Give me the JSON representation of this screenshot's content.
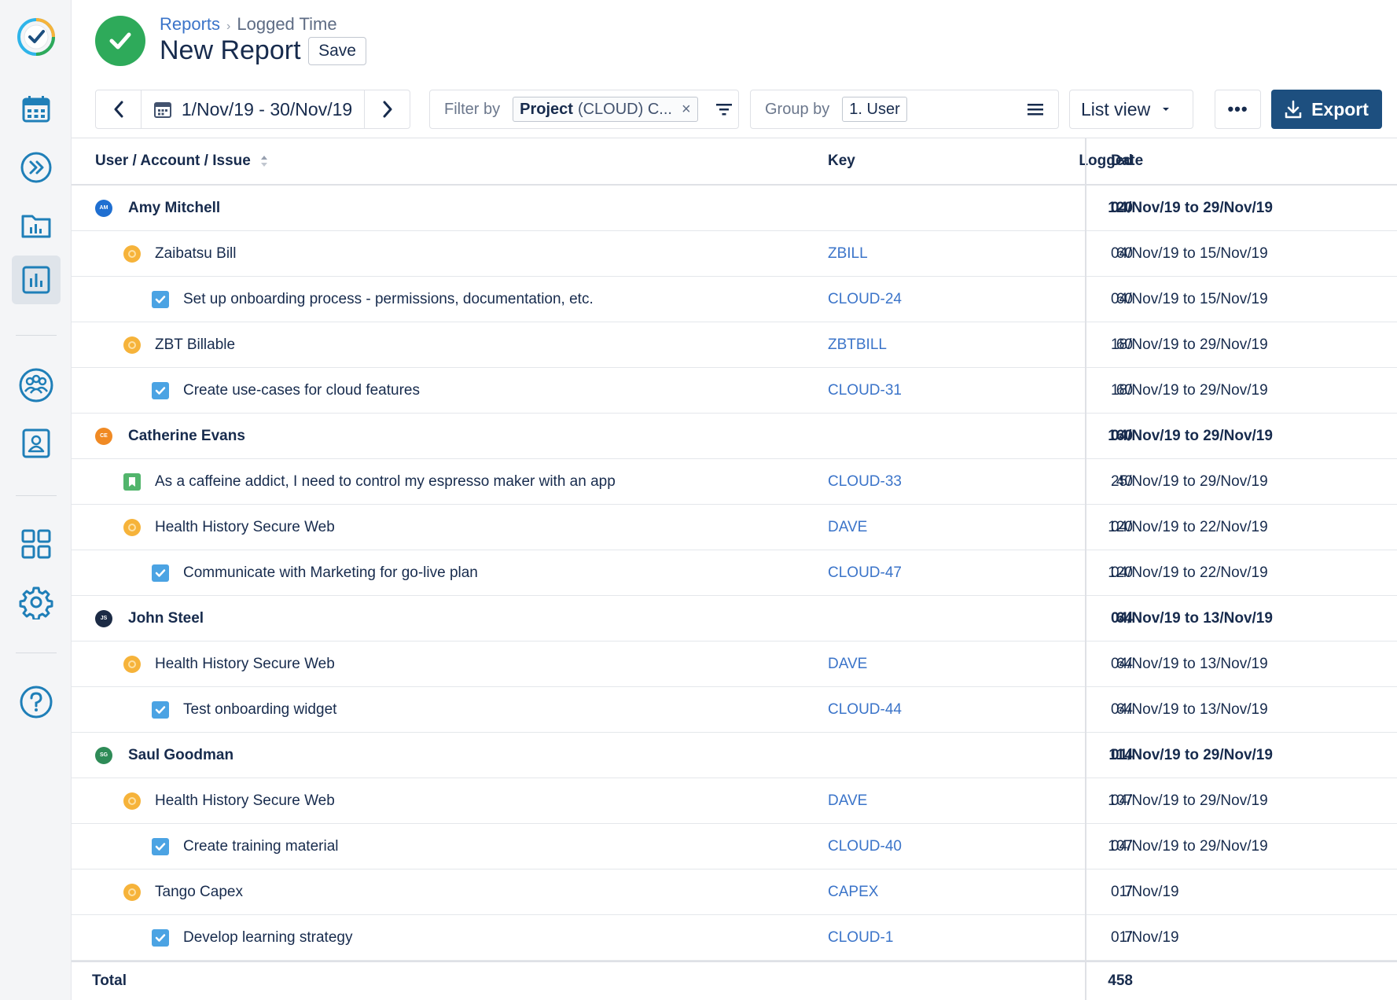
{
  "header": {
    "breadcrumb_root": "Reports",
    "breadcrumb_current": "Logged Time",
    "title": "New Report",
    "save_label": "Save"
  },
  "toolbar": {
    "date_range": "1/Nov/19 - 30/Nov/19",
    "filter_label": "Filter by",
    "filter_chip_key": "Project",
    "filter_chip_value": "(CLOUD) C...",
    "group_label": "Group by",
    "group_value": "1. User",
    "view_label": "List view",
    "more_label": "•••",
    "export_label": "Export"
  },
  "table": {
    "columns": {
      "name": "User / Account / Issue",
      "key": "Key",
      "logged": "Logged",
      "date": "Date"
    },
    "rows": [
      {
        "level": 0,
        "type": "user",
        "initials": "AM",
        "avatar_color": "#1f6fd1",
        "name": "Amy Mitchell",
        "key": "",
        "logged": "120",
        "date": "04/Nov/19 to 29/Nov/19"
      },
      {
        "level": 1,
        "type": "account",
        "name": "Zaibatsu Bill",
        "key": "ZBILL",
        "logged": "60",
        "date": "04/Nov/19 to 15/Nov/19"
      },
      {
        "level": 2,
        "type": "task",
        "name": "Set up onboarding process - permissions, documentation, etc.",
        "key": "CLOUD-24",
        "logged": "60",
        "date": "04/Nov/19 to 15/Nov/19"
      },
      {
        "level": 1,
        "type": "account",
        "name": "ZBT Billable",
        "key": "ZBTBILL",
        "logged": "60",
        "date": "18/Nov/19 to 29/Nov/19"
      },
      {
        "level": 2,
        "type": "task",
        "name": "Create use-cases for cloud features",
        "key": "CLOUD-31",
        "logged": "60",
        "date": "18/Nov/19 to 29/Nov/19"
      },
      {
        "level": 0,
        "type": "user",
        "initials": "CE",
        "avatar_color": "#f08a24",
        "name": "Catherine Evans",
        "key": "",
        "logged": "160",
        "date": "04/Nov/19 to 29/Nov/19"
      },
      {
        "level": 1,
        "type": "story",
        "name": "As a caffeine addict, I need to control my espresso maker with an app",
        "key": "CLOUD-33",
        "logged": "40",
        "date": "25/Nov/19 to 29/Nov/19"
      },
      {
        "level": 1,
        "type": "account",
        "name": "Health History Secure Web",
        "key": "DAVE",
        "logged": "120",
        "date": "04/Nov/19 to 22/Nov/19"
      },
      {
        "level": 2,
        "type": "task",
        "name": "Communicate with Marketing for go-live plan",
        "key": "CLOUD-47",
        "logged": "120",
        "date": "04/Nov/19 to 22/Nov/19"
      },
      {
        "level": 0,
        "type": "user",
        "initials": "JS",
        "avatar_color": "#1c2b45",
        "name": "John Steel",
        "key": "",
        "logged": "64",
        "date": "04/Nov/19 to 13/Nov/19"
      },
      {
        "level": 1,
        "type": "account",
        "name": "Health History Secure Web",
        "key": "DAVE",
        "logged": "64",
        "date": "04/Nov/19 to 13/Nov/19"
      },
      {
        "level": 2,
        "type": "task",
        "name": "Test onboarding widget",
        "key": "CLOUD-44",
        "logged": "64",
        "date": "04/Nov/19 to 13/Nov/19"
      },
      {
        "level": 0,
        "type": "user",
        "initials": "SG",
        "avatar_color": "#2e8b57",
        "name": "Saul Goodman",
        "key": "",
        "logged": "114",
        "date": "01/Nov/19 to 29/Nov/19"
      },
      {
        "level": 1,
        "type": "account",
        "name": "Health History Secure Web",
        "key": "DAVE",
        "logged": "107",
        "date": "04/Nov/19 to 29/Nov/19"
      },
      {
        "level": 2,
        "type": "task",
        "name": "Create training material",
        "key": "CLOUD-40",
        "logged": "107",
        "date": "04/Nov/19 to 29/Nov/19"
      },
      {
        "level": 1,
        "type": "account",
        "name": "Tango Capex",
        "key": "CAPEX",
        "logged": "7",
        "date": "01/Nov/19"
      },
      {
        "level": 2,
        "type": "task",
        "name": "Develop learning strategy",
        "key": "CLOUD-1",
        "logged": "7",
        "date": "01/Nov/19"
      }
    ],
    "total_label": "Total",
    "total_value": "458"
  },
  "sidebar": {
    "items": [
      "app-logo-icon",
      "calendar-icon",
      "forward-icon",
      "folder-chart-icon",
      "reports-icon",
      "team-icon",
      "profile-icon",
      "apps-grid-icon",
      "settings-icon",
      "help-icon"
    ]
  },
  "colors": {
    "accent": "#1d4f7f",
    "success": "#2eaa5a",
    "link": "#3b74c9",
    "icon": "#1f7fb8"
  }
}
